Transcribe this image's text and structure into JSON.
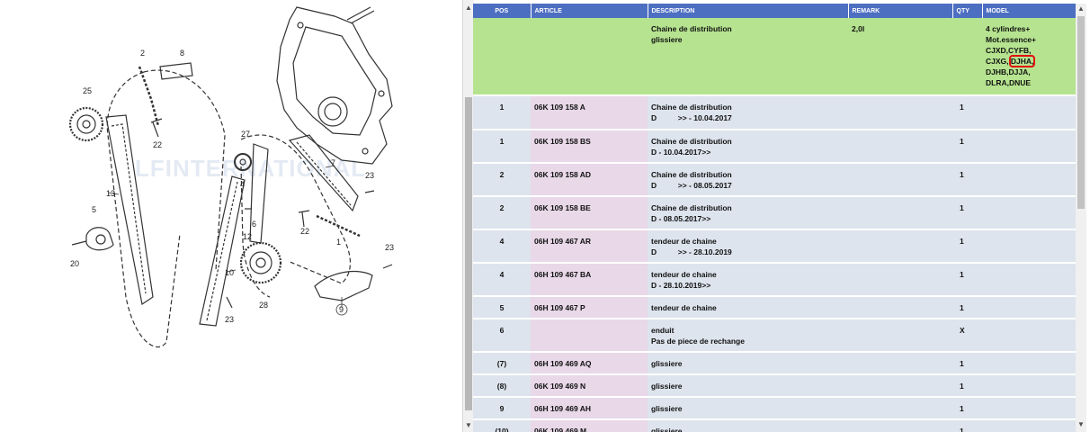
{
  "diagram": {
    "callouts": [
      "2",
      "8",
      "25",
      "22",
      "27",
      "4",
      "13",
      "5",
      "6",
      "12",
      "20",
      "10",
      "28",
      "23",
      "7",
      "23",
      "22",
      "1",
      "23",
      "9"
    ],
    "watermark": "LFINTERNATIONAL"
  },
  "table": {
    "headers": [
      "POS",
      "ARTICLE",
      "DESCRIPTION",
      "REMARK",
      "QTY",
      "MODEL"
    ],
    "highlight_row": {
      "desc1": "Chaine de distribution",
      "desc2": "glissiere",
      "remark": "2,0l",
      "model_a": "4 cylindres+ Mot.essence+ CJXD,CYFB, CJXG,",
      "model_boxed": "DJHA,",
      "model_b": " DJHB,DJJA, DLRA,DNUE"
    },
    "rows": [
      {
        "pos": "1",
        "article": "06K 109 158 A",
        "desc": "Chaine de distribution\nD          >> - 10.04.2017",
        "qty": "1"
      },
      {
        "pos": "1",
        "article": "06K 109 158 BS",
        "desc": "Chaine de distribution\nD - 10.04.2017>>",
        "qty": "1"
      },
      {
        "pos": "2",
        "article": "06K 109 158 AD",
        "desc": "Chaine de distribution\nD          >> - 08.05.2017",
        "qty": "1"
      },
      {
        "pos": "2",
        "article": "06K 109 158 BE",
        "desc": "Chaine de distribution\nD - 08.05.2017>>",
        "qty": "1"
      },
      {
        "pos": "4",
        "article": "06H 109 467 AR",
        "desc": "tendeur de chaine\nD          >> - 28.10.2019",
        "qty": "1"
      },
      {
        "pos": "4",
        "article": "06H 109 467 BA",
        "desc": "tendeur de chaine\nD - 28.10.2019>>",
        "qty": "1"
      },
      {
        "pos": "5",
        "article": "06H 109 467 P",
        "desc": "tendeur de chaine",
        "qty": "1"
      },
      {
        "pos": "6",
        "article": "",
        "desc": "enduit\nPas de piece de rechange",
        "qty": "X"
      },
      {
        "pos": "(7)",
        "article": "06H 109 469 AQ",
        "desc": "glissiere",
        "qty": "1"
      },
      {
        "pos": "(8)",
        "article": "06K 109 469 N",
        "desc": "glissiere",
        "qty": "1"
      },
      {
        "pos": "9",
        "article": "06H 109 469 AH",
        "desc": "glissiere",
        "qty": "1"
      },
      {
        "pos": "(10)",
        "article": "06K 109 469 M",
        "desc": "glissiere",
        "qty": "1"
      }
    ]
  },
  "colors": {
    "header": "#4d6fc2",
    "highlight": "#b5e38f",
    "row": "#dde4ed",
    "article_cell": "#e8d8e8",
    "red_box": "#e01010"
  },
  "icons": {
    "scroll_up": "▲",
    "scroll_down": "▼"
  }
}
